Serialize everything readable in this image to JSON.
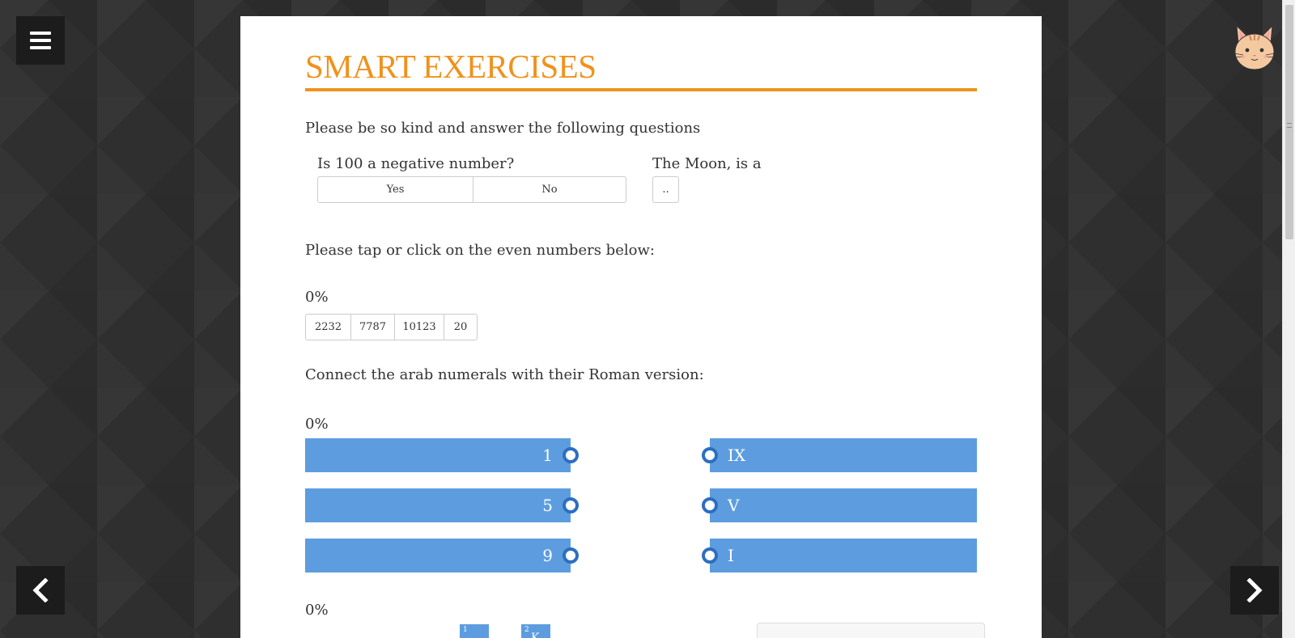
{
  "header": {
    "title": "SMART EXERCISES"
  },
  "intro": "Please be so kind and answer the following questions",
  "question1": {
    "label": "Is 100 a negative number?",
    "options": [
      "Yes",
      "No"
    ]
  },
  "question2": {
    "label": "The Moon, is a",
    "dropdown_value": ".."
  },
  "even_numbers": {
    "prompt": "Please tap or click on the even numbers below:",
    "progress": "0%",
    "options": [
      "2232",
      "7787",
      "10123",
      "20"
    ]
  },
  "roman": {
    "prompt": "Connect the arab numerals with their Roman version:",
    "progress": "0%",
    "left": [
      "1",
      "5",
      "9"
    ],
    "right": [
      "IX",
      "V",
      "I"
    ]
  },
  "crossword": {
    "progress": "0%",
    "cells": [
      {
        "number": "1",
        "letter": ""
      },
      {
        "number": "2",
        "letter": "K"
      }
    ]
  },
  "colors": {
    "accent": "#f0921c",
    "match_fill": "#5d9ddf",
    "match_dot": "#2c6fc0"
  },
  "icons": {
    "menu": "hamburger-icon",
    "prev": "chevron-left-icon",
    "next": "chevron-right-icon",
    "avatar": "cat-face-icon"
  }
}
